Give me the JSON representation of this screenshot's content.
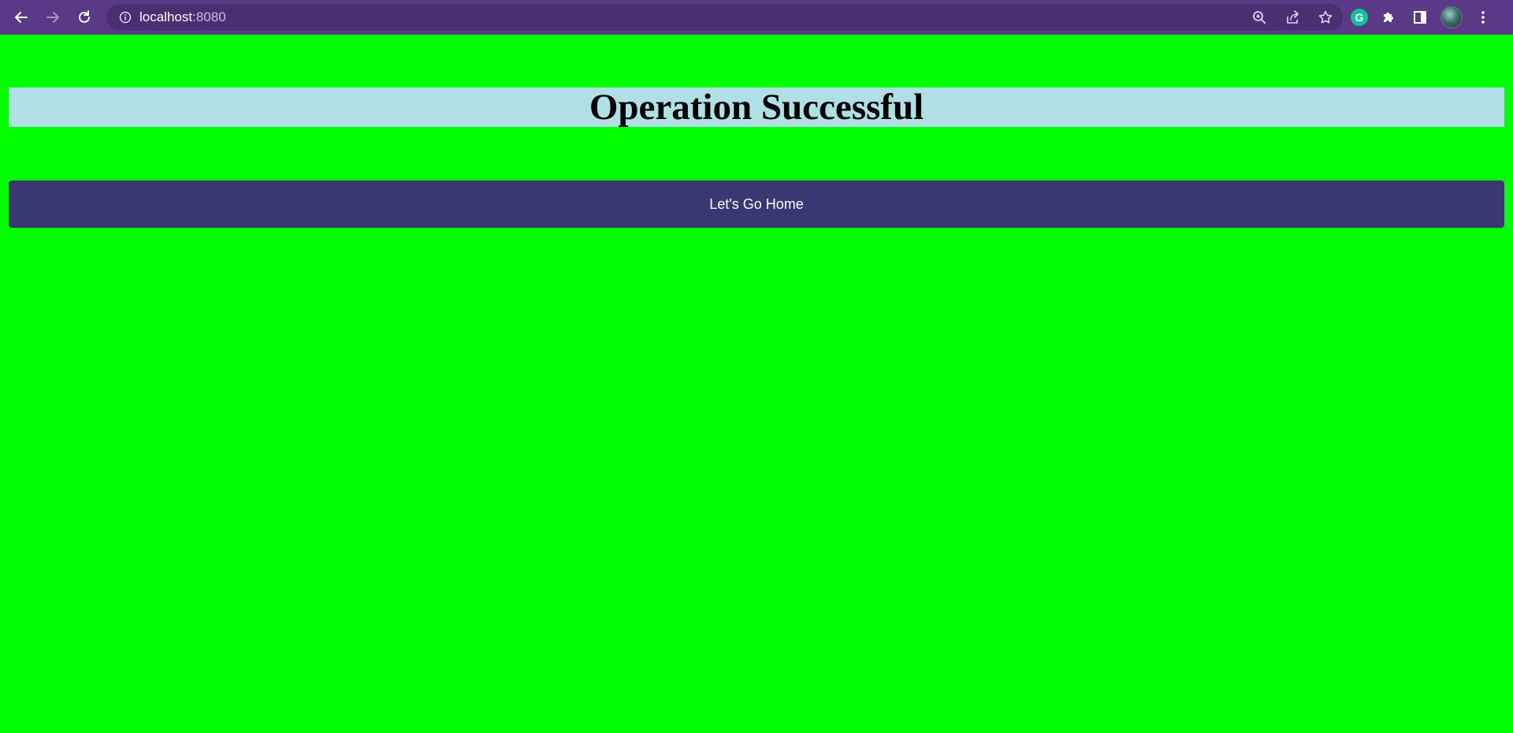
{
  "browser": {
    "url_host": "localhost",
    "url_port": ":8080",
    "icons": {
      "back": "arrow-left-icon",
      "forward": "arrow-right-icon",
      "reload": "reload-icon",
      "info": "info-icon",
      "zoom": "zoom-icon",
      "share": "share-icon",
      "bookmark": "star-icon",
      "grammarly": "grammarly-icon",
      "extensions": "puzzle-icon",
      "side_panel": "side-panel-icon",
      "profile": "avatar",
      "menu": "kebab-menu-icon"
    },
    "grammarly_letter": "G",
    "theme_color": "#5a3a87"
  },
  "page": {
    "background_color": "#00ff00",
    "banner": {
      "title": "Operation Successful",
      "background_color": "#b0e0e6"
    },
    "home_button": {
      "label": "Let's Go Home",
      "background_color": "#3a3872"
    }
  }
}
